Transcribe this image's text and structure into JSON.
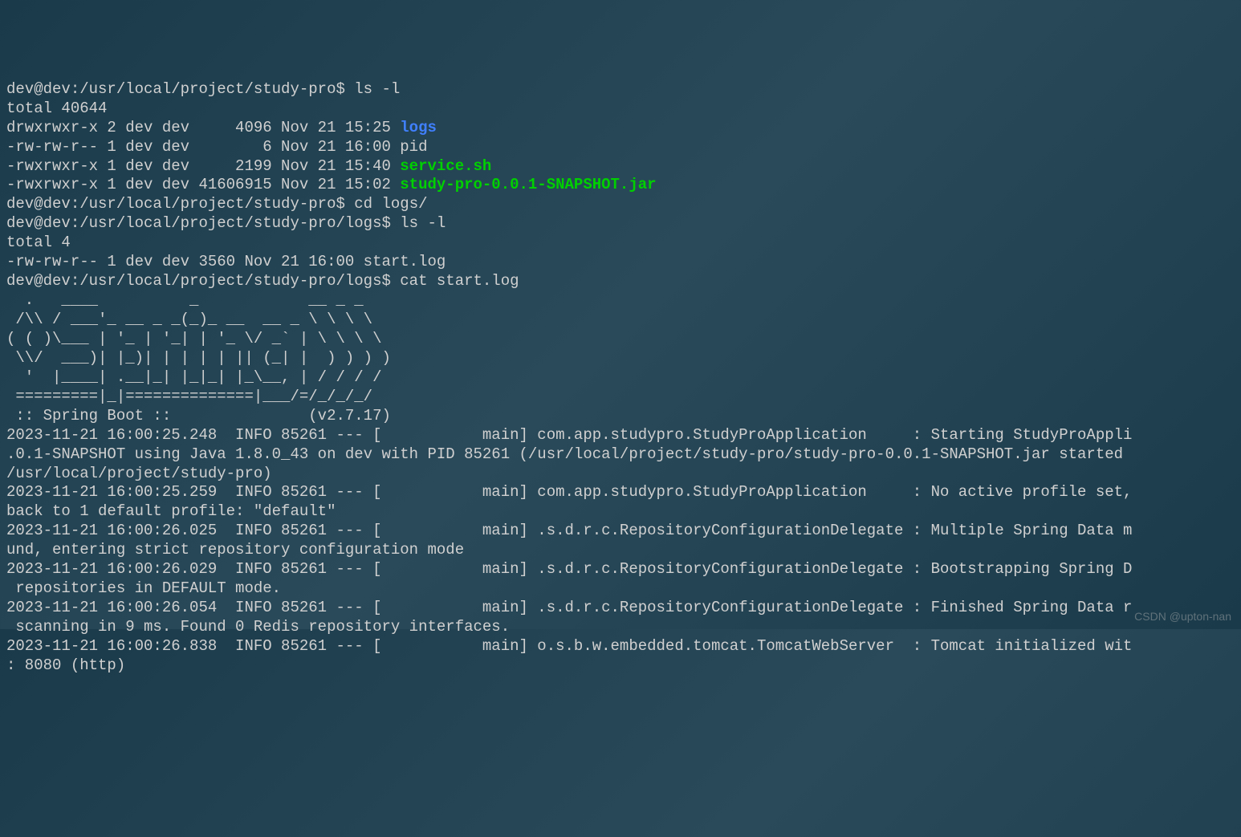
{
  "session": {
    "prompt1": "dev@dev:/usr/local/project/study-pro$ ",
    "cmd1": "ls -l",
    "ls1_total": "total 40644",
    "ls1_r1_perm": "drwxrwxr-x 2 dev dev     4096 Nov 21 15:25 ",
    "ls1_r1_name": "logs",
    "ls1_r2": "-rw-rw-r-- 1 dev dev        6 Nov 21 16:00 pid",
    "ls1_r3_perm": "-rwxrwxr-x 1 dev dev     2199 Nov 21 15:40 ",
    "ls1_r3_name": "service.sh",
    "ls1_r4_perm": "-rwxrwxr-x 1 dev dev 41606915 Nov 21 15:02 ",
    "ls1_r4_name": "study-pro-0.0.1-SNAPSHOT.jar",
    "prompt2": "dev@dev:/usr/local/project/study-pro$ ",
    "cmd2": "cd logs/",
    "prompt3": "dev@dev:/usr/local/project/study-pro/logs$ ",
    "cmd3": "ls -l",
    "ls2_total": "total 4",
    "ls2_r1": "-rw-rw-r-- 1 dev dev 3560 Nov 21 16:00 start.log",
    "prompt4": "dev@dev:/usr/local/project/study-pro/logs$ ",
    "cmd4": "cat start.log",
    "blank": "",
    "banner_l1": "  .   ____          _            __ _ _",
    "banner_l2": " /\\\\ / ___'_ __ _ _(_)_ __  __ _ \\ \\ \\ \\",
    "banner_l3": "( ( )\\___ | '_ | '_| | '_ \\/ _` | \\ \\ \\ \\",
    "banner_l4": " \\\\/  ___)| |_)| | | | | || (_| |  ) ) ) )",
    "banner_l5": "  '  |____| .__|_| |_|_| |_\\__, | / / / /",
    "banner_l6": " =========|_|==============|___/=/_/_/_/",
    "banner_l7": " :: Spring Boot ::               (v2.7.17)",
    "log_l1": "2023-11-21 16:00:25.248  INFO 85261 --- [           main] com.app.studypro.StudyProApplication     : Starting StudyProAppli",
    "log_l2": ".0.1-SNAPSHOT using Java 1.8.0_43 on dev with PID 85261 (/usr/local/project/study-pro/study-pro-0.0.1-SNAPSHOT.jar started ",
    "log_l3": "/usr/local/project/study-pro)",
    "log_l4": "2023-11-21 16:00:25.259  INFO 85261 --- [           main] com.app.studypro.StudyProApplication     : No active profile set,",
    "log_l5": "back to 1 default profile: \"default\"",
    "log_l6": "2023-11-21 16:00:26.025  INFO 85261 --- [           main] .s.d.r.c.RepositoryConfigurationDelegate : Multiple Spring Data m",
    "log_l7": "und, entering strict repository configuration mode",
    "log_l8": "2023-11-21 16:00:26.029  INFO 85261 --- [           main] .s.d.r.c.RepositoryConfigurationDelegate : Bootstrapping Spring D",
    "log_l9": " repositories in DEFAULT mode.",
    "log_l10": "2023-11-21 16:00:26.054  INFO 85261 --- [           main] .s.d.r.c.RepositoryConfigurationDelegate : Finished Spring Data r",
    "log_l11": " scanning in 9 ms. Found 0 Redis repository interfaces.",
    "log_l12": "2023-11-21 16:00:26.838  INFO 85261 --- [           main] o.s.b.w.embedded.tomcat.TomcatWebServer  : Tomcat initialized wit",
    "log_l13": ": 8080 (http)"
  },
  "watermark": "CSDN @upton-nan"
}
